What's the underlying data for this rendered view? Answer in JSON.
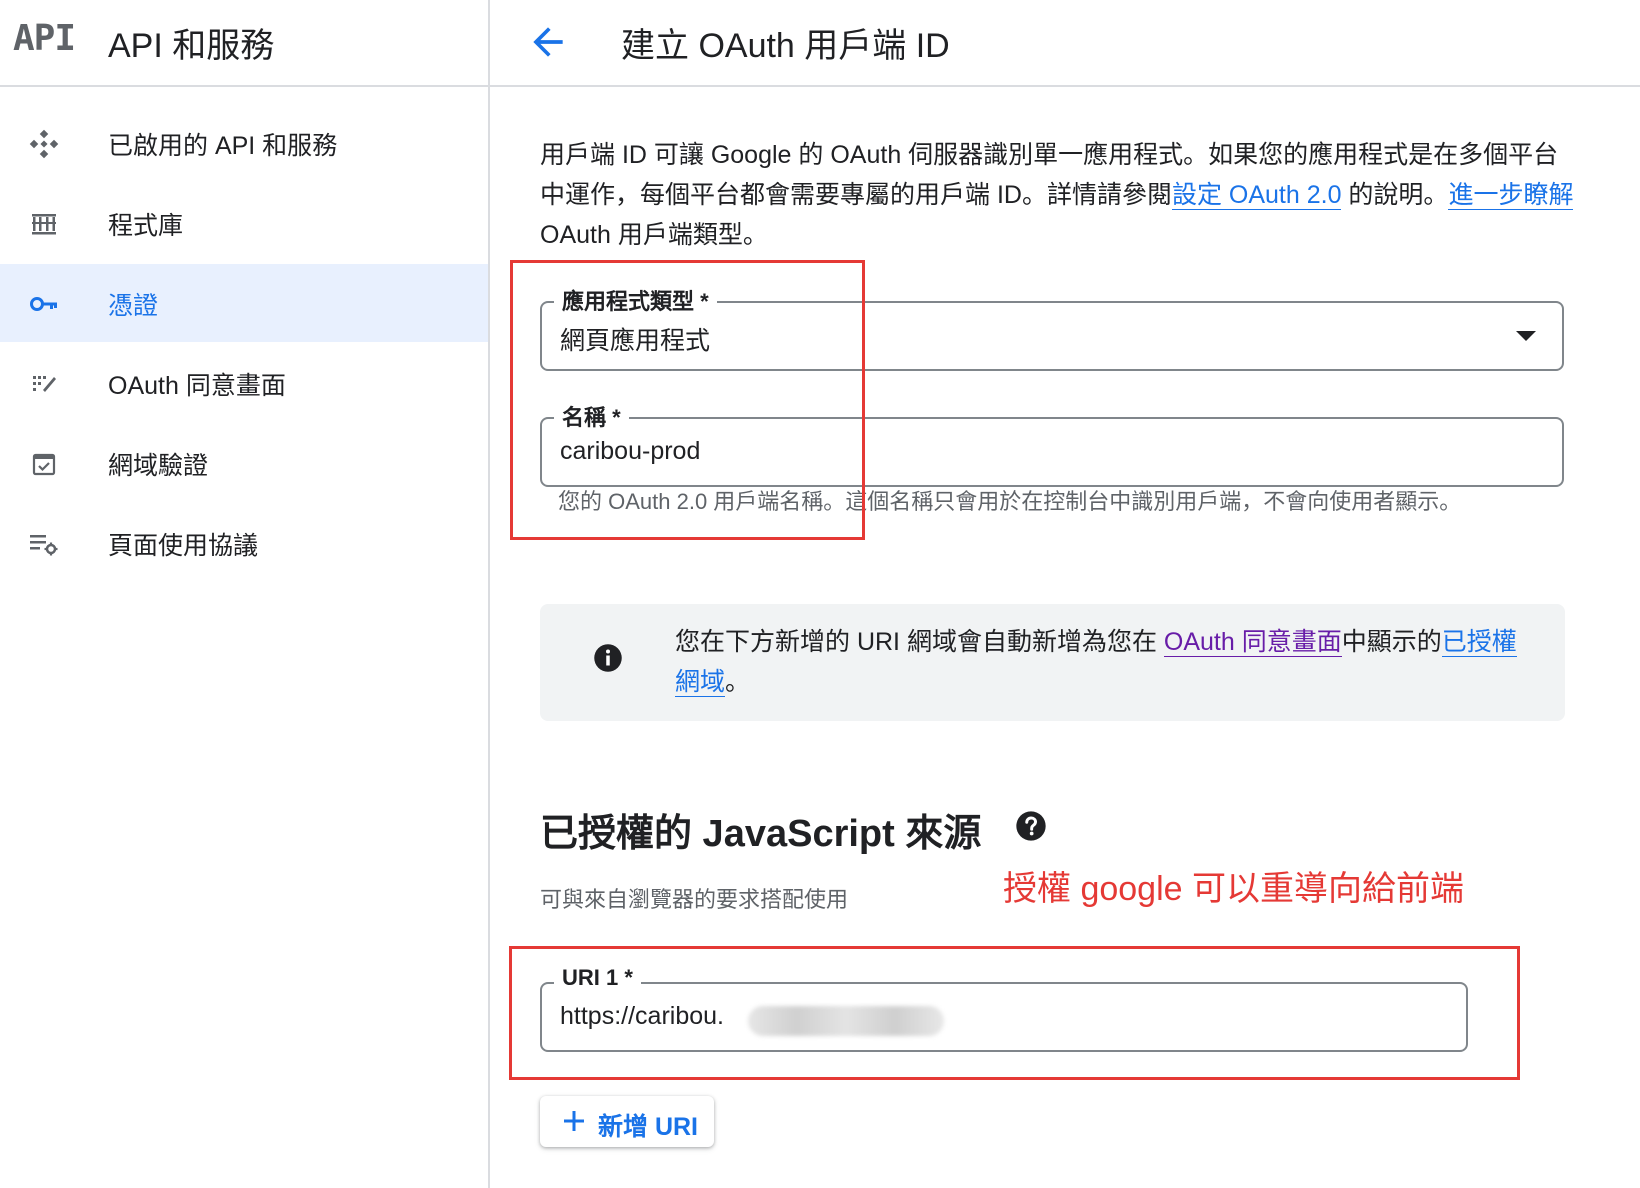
{
  "header": {
    "logo_text": "API",
    "product_title": "API 和服務",
    "page_title": "建立 OAuth 用戶端 ID"
  },
  "sidebar": {
    "items": [
      {
        "label": "已啟用的 API 和服務",
        "icon": "enabled-apis-icon"
      },
      {
        "label": "程式庫",
        "icon": "library-icon"
      },
      {
        "label": "憑證",
        "icon": "key-icon",
        "active": true
      },
      {
        "label": "OAuth 同意畫面",
        "icon": "consent-screen-icon"
      },
      {
        "label": "網域驗證",
        "icon": "domain-verification-icon"
      },
      {
        "label": "頁面使用協議",
        "icon": "page-usage-icon"
      }
    ]
  },
  "intro": {
    "text1": "用戶端 ID 可讓 Google 的 OAuth 伺服器識別單一應用程式。如果您的應用程式是在多個平台中運作，每個平台都會需要專屬的用戶端 ID。詳情請參閱",
    "link1": "設定 OAuth 2.0",
    "text2": " 的說明。",
    "link2": "進一步瞭解",
    "text3": " OAuth 用戶端類型。"
  },
  "form": {
    "app_type_label": "應用程式類型 *",
    "app_type_value": "網頁應用程式",
    "name_label": "名稱 *",
    "name_value": "caribou-prod",
    "name_hint": "您的 OAuth 2.0 用戶端名稱。這個名稱只會用於在控制台中識別用戶端，不會向使用者顯示。"
  },
  "info": {
    "text1": "您在下方新增的 URI 網域會自動新增為您在 ",
    "link1": "OAuth 同意畫面",
    "text2": "中顯示的",
    "link2": "已授權網域",
    "text3": "。"
  },
  "js_origins": {
    "title": "已授權的 JavaScript 來源",
    "subtitle": "可與來自瀏覽器的要求搭配使用",
    "uri_label": "URI 1 *",
    "uri_value": "https://caribou.",
    "add_button": "新增 URI"
  },
  "annotation": "授權 google 可以重導向給前端",
  "colors": {
    "accent": "#1a73e8",
    "visited_link": "#681da8",
    "annotation": "#e53935",
    "active_nav_bg": "#e8f0fe"
  }
}
